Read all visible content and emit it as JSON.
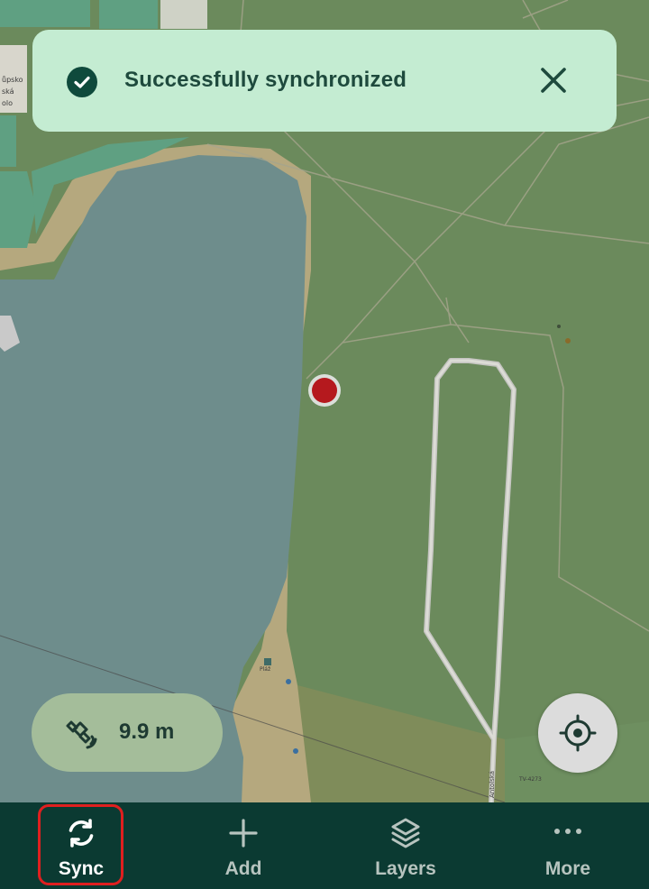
{
  "toast": {
    "message": "Successfully synchronized",
    "icon": "check-circle-icon",
    "close_icon": "close-icon"
  },
  "gps": {
    "accuracy": "9.9 m",
    "icon": "satellite-icon"
  },
  "locate": {
    "icon": "crosshair-icon"
  },
  "map_labels": {
    "place_line1": "ůpsko",
    "place_line2": "ská",
    "place_line3": "olo",
    "road": "Antolská",
    "spot": "Pláž",
    "height": "TV-4273"
  },
  "bottom_nav": {
    "items": [
      {
        "label": "Sync",
        "icon": "sync-icon",
        "active": true
      },
      {
        "label": "Add",
        "icon": "plus-icon",
        "active": false
      },
      {
        "label": "Layers",
        "icon": "layers-icon",
        "active": false
      },
      {
        "label": "More",
        "icon": "more-dots-icon",
        "active": false
      }
    ]
  },
  "colors": {
    "nav_background": "#0b3a32",
    "toast_background": "#c4ecd2",
    "water": "#6e8d8c",
    "forest": "#6b8a5c",
    "sand": "#b7a87f",
    "marker": "#b5191e",
    "active_highlight": "#e01f1f"
  }
}
